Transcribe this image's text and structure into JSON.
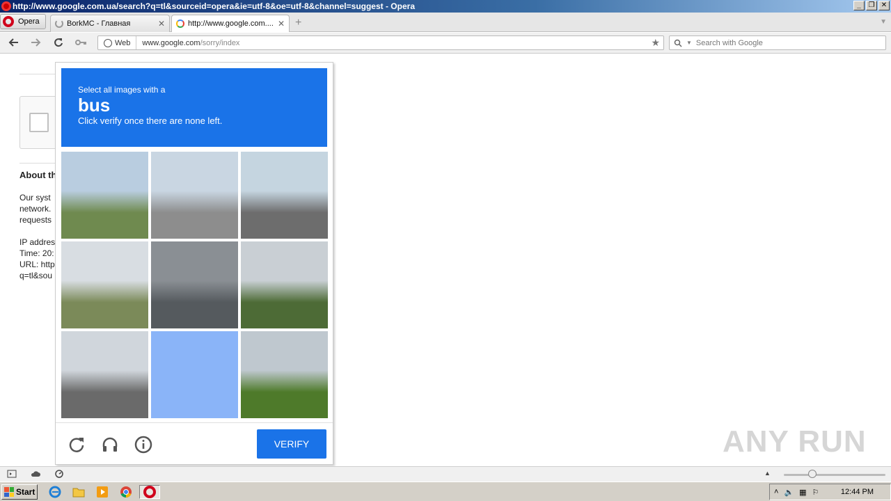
{
  "window": {
    "title": "http://www.google.com.ua/search?q=tl&sourceid=opera&ie=utf-8&oe=utf-8&channel=suggest - Opera",
    "buttons": [
      "_",
      "❐",
      "✕"
    ]
  },
  "tabs": {
    "menu_label": "Opera",
    "items": [
      {
        "label": "BorkMC - Главная",
        "icon": "spinner-icon"
      },
      {
        "label": "http://www.google.com....",
        "icon": "google-icon"
      }
    ]
  },
  "address": {
    "badge": "Web",
    "url_host": "www.google.com",
    "url_path": "/sorry/index",
    "search_placeholder": "Search with Google"
  },
  "page": {
    "about_heading": "About th",
    "lines": [
      "Our syst",
      "network.",
      "requests",
      "",
      "IP addres",
      "Time: 20:",
      "URL: http",
      "q=tl&sou"
    ]
  },
  "challenge": {
    "line1": "Select all images with a",
    "keyword": "bus",
    "line3": "Click verify once there are none left.",
    "verify_label": "VERIFY",
    "tiles": [
      {
        "selected": false,
        "top": "#b9cde0",
        "bottom": "#6f8a4f"
      },
      {
        "selected": false,
        "top": "#c9d6e2",
        "bottom": "#8d8d8d"
      },
      {
        "selected": false,
        "top": "#c5d5e0",
        "bottom": "#6d6d6d"
      },
      {
        "selected": false,
        "top": "#d8dde2",
        "bottom": "#7b8a59"
      },
      {
        "selected": false,
        "top": "#8a8f94",
        "bottom": "#555a5e"
      },
      {
        "selected": false,
        "top": "#c9cfd4",
        "bottom": "#4d6b36"
      },
      {
        "selected": false,
        "top": "#d0d6dc",
        "bottom": "#6a6a6a"
      },
      {
        "selected": true,
        "top": "#8ab4f8",
        "bottom": "#8ab4f8"
      },
      {
        "selected": false,
        "top": "#bfc8cf",
        "bottom": "#4e7a2a"
      }
    ]
  },
  "statusbar": {
    "icons": [
      "panel-icon",
      "cloud-icon",
      "speed-dial-icon"
    ]
  },
  "taskbar": {
    "start_label": "Start",
    "clock": "12:44 PM"
  },
  "watermark": "ANY RUN",
  "colors": {
    "accent": "#1a73e8",
    "selected_tile": "#8ab4f8"
  }
}
